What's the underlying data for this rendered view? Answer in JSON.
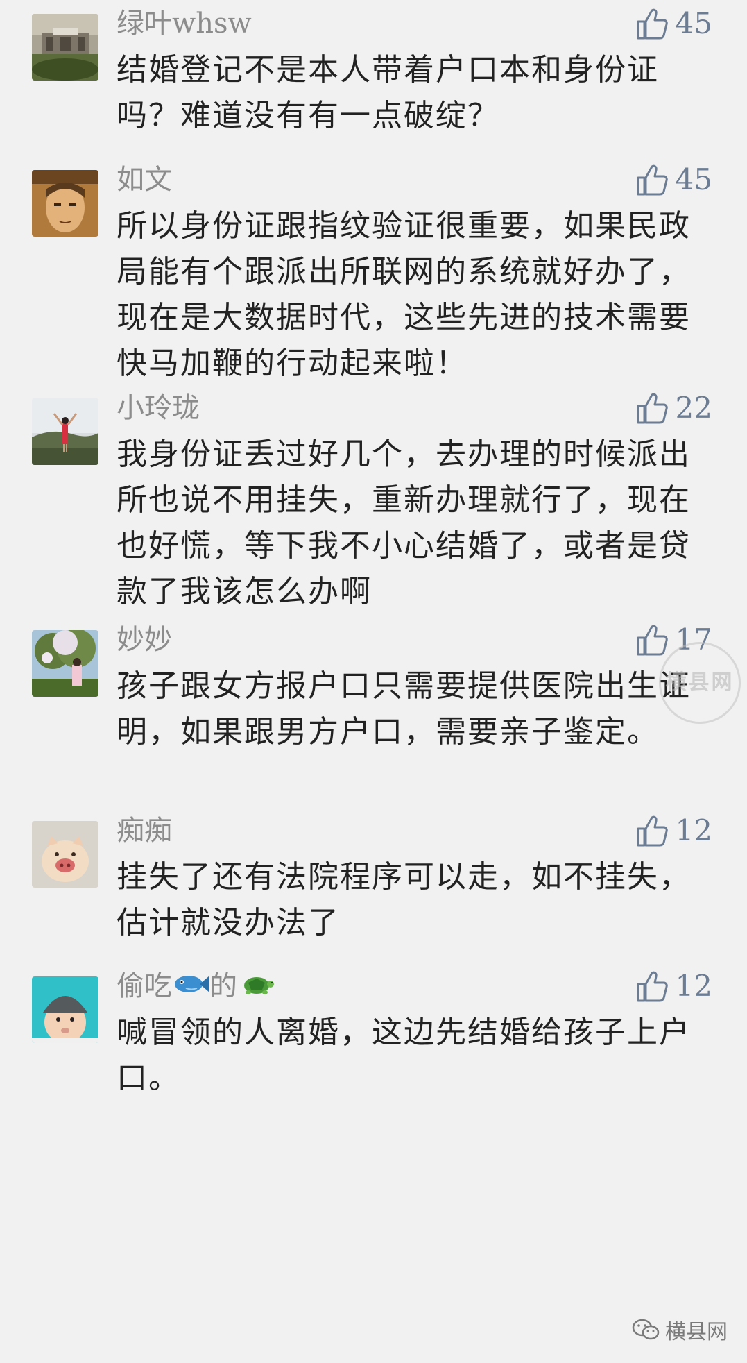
{
  "comments": [
    {
      "nickname": "绿叶whsw",
      "likes": "45",
      "content": "结婚登记不是本人带着户口本和身份证吗？难道没有有一点破绽？",
      "avatar_icon": "building-photo-avatar"
    },
    {
      "nickname": "如文",
      "likes": "45",
      "content": "所以身份证跟指纹验证很重要，如果民政局能有个跟派出所联网的系统就好办了，现在是大数据时代，这些先进的技术需要快马加鞭的行动起来啦！",
      "avatar_icon": "anime-face-avatar"
    },
    {
      "nickname": "小玲珑",
      "likes": "22",
      "content": "我身份证丢过好几个，去办理的时候派出所也说不用挂失，重新办理就行了，现在也好慌，等下我不小心结婚了，或者是贷款了我该怎么办啊",
      "avatar_icon": "woman-hills-avatar"
    },
    {
      "nickname": "妙妙",
      "likes": "17",
      "content": "孩子跟女方报户口只需要提供医院出生证明，如果跟男方户口，需要亲子鉴定。",
      "avatar_icon": "tree-girl-avatar"
    },
    {
      "nickname": "痴痴",
      "likes": "12",
      "content": "挂失了还有法院程序可以走，如不挂失，估计就没办法了",
      "avatar_icon": "pig-bun-avatar"
    },
    {
      "nickname_prefix": "偷吃",
      "nickname_middle": "的",
      "likes": "12",
      "content": "喊冒领的人离婚，这边先结婚给孩子上户口。",
      "avatar_icon": "baby-hat-avatar",
      "emoji_1": "fish-emoji",
      "emoji_2": "turtle-emoji"
    }
  ],
  "watermark": {
    "main": "横县网"
  },
  "source": {
    "label": "横县网",
    "icon": "wechat-icon"
  },
  "colors": {
    "background": "#f1f1f1",
    "nickname": "#8c8c8c",
    "like": "#6c7c93",
    "content": "#222222"
  }
}
